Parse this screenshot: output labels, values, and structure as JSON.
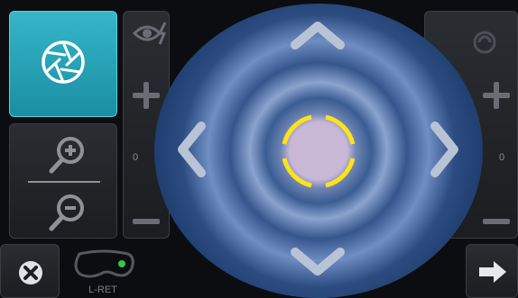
{
  "capture": {
    "shutter_icon": "aperture-icon"
  },
  "zoom": {
    "in_icon": "zoom-in-icon",
    "out_icon": "zoom-out-icon"
  },
  "flash": {
    "icon": "eye-flash-icon",
    "level": "0"
  },
  "focus": {
    "icon": "focus-icon",
    "level": "0"
  },
  "navigation": {
    "up": "chevron-up-icon",
    "down": "chevron-down-icon",
    "left": "chevron-left-icon",
    "right": "chevron-right-icon"
  },
  "eye_mode": {
    "label": "L-RET",
    "indicator_color": "#33c84a"
  },
  "actions": {
    "cancel_icon": "close-icon",
    "next_icon": "arrow-right-icon"
  },
  "colors": {
    "accent": "#2aa7bb",
    "target_ring": "#ffe21a"
  }
}
